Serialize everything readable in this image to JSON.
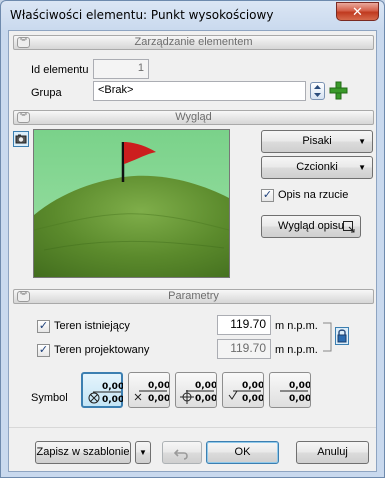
{
  "window": {
    "title": "Właściwości elementu: Punkt wysokościowy",
    "close_label": "✕"
  },
  "section_element": {
    "header": "Zarządzanie elementem",
    "id_label": "Id elementu",
    "id_value": "1",
    "group_label": "Grupa",
    "group_value": "<Brak>"
  },
  "section_view": {
    "header": "Wygląd",
    "pens_label": "Pisaki",
    "fonts_label": "Czcionki",
    "show_on_projection_label": "Opis na rzucie",
    "show_on_projection_checked": true,
    "description_view_label": "Wygląd opisu"
  },
  "section_params": {
    "header": "Parametry",
    "existing_terrain_label": "Teren istniejący",
    "existing_terrain_checked": true,
    "existing_terrain_value": "119.70",
    "existing_terrain_unit": "m n.p.m.",
    "designed_terrain_label": "Teren projektowany",
    "designed_terrain_checked": true,
    "designed_terrain_value": "119.70",
    "designed_terrain_unit": "m n.p.m.",
    "symbol_label": "Symbol",
    "symbol_value_top": "0,00",
    "symbol_value_bottom": "0,00"
  },
  "footer": {
    "save_template_label": "Zapisz w szablonie",
    "ok_label": "OK",
    "cancel_label": "Anuluj"
  },
  "colors": {
    "accent": "#3c7fb1",
    "flag": "#cc1e1e",
    "grass": "#6a9a3a"
  }
}
